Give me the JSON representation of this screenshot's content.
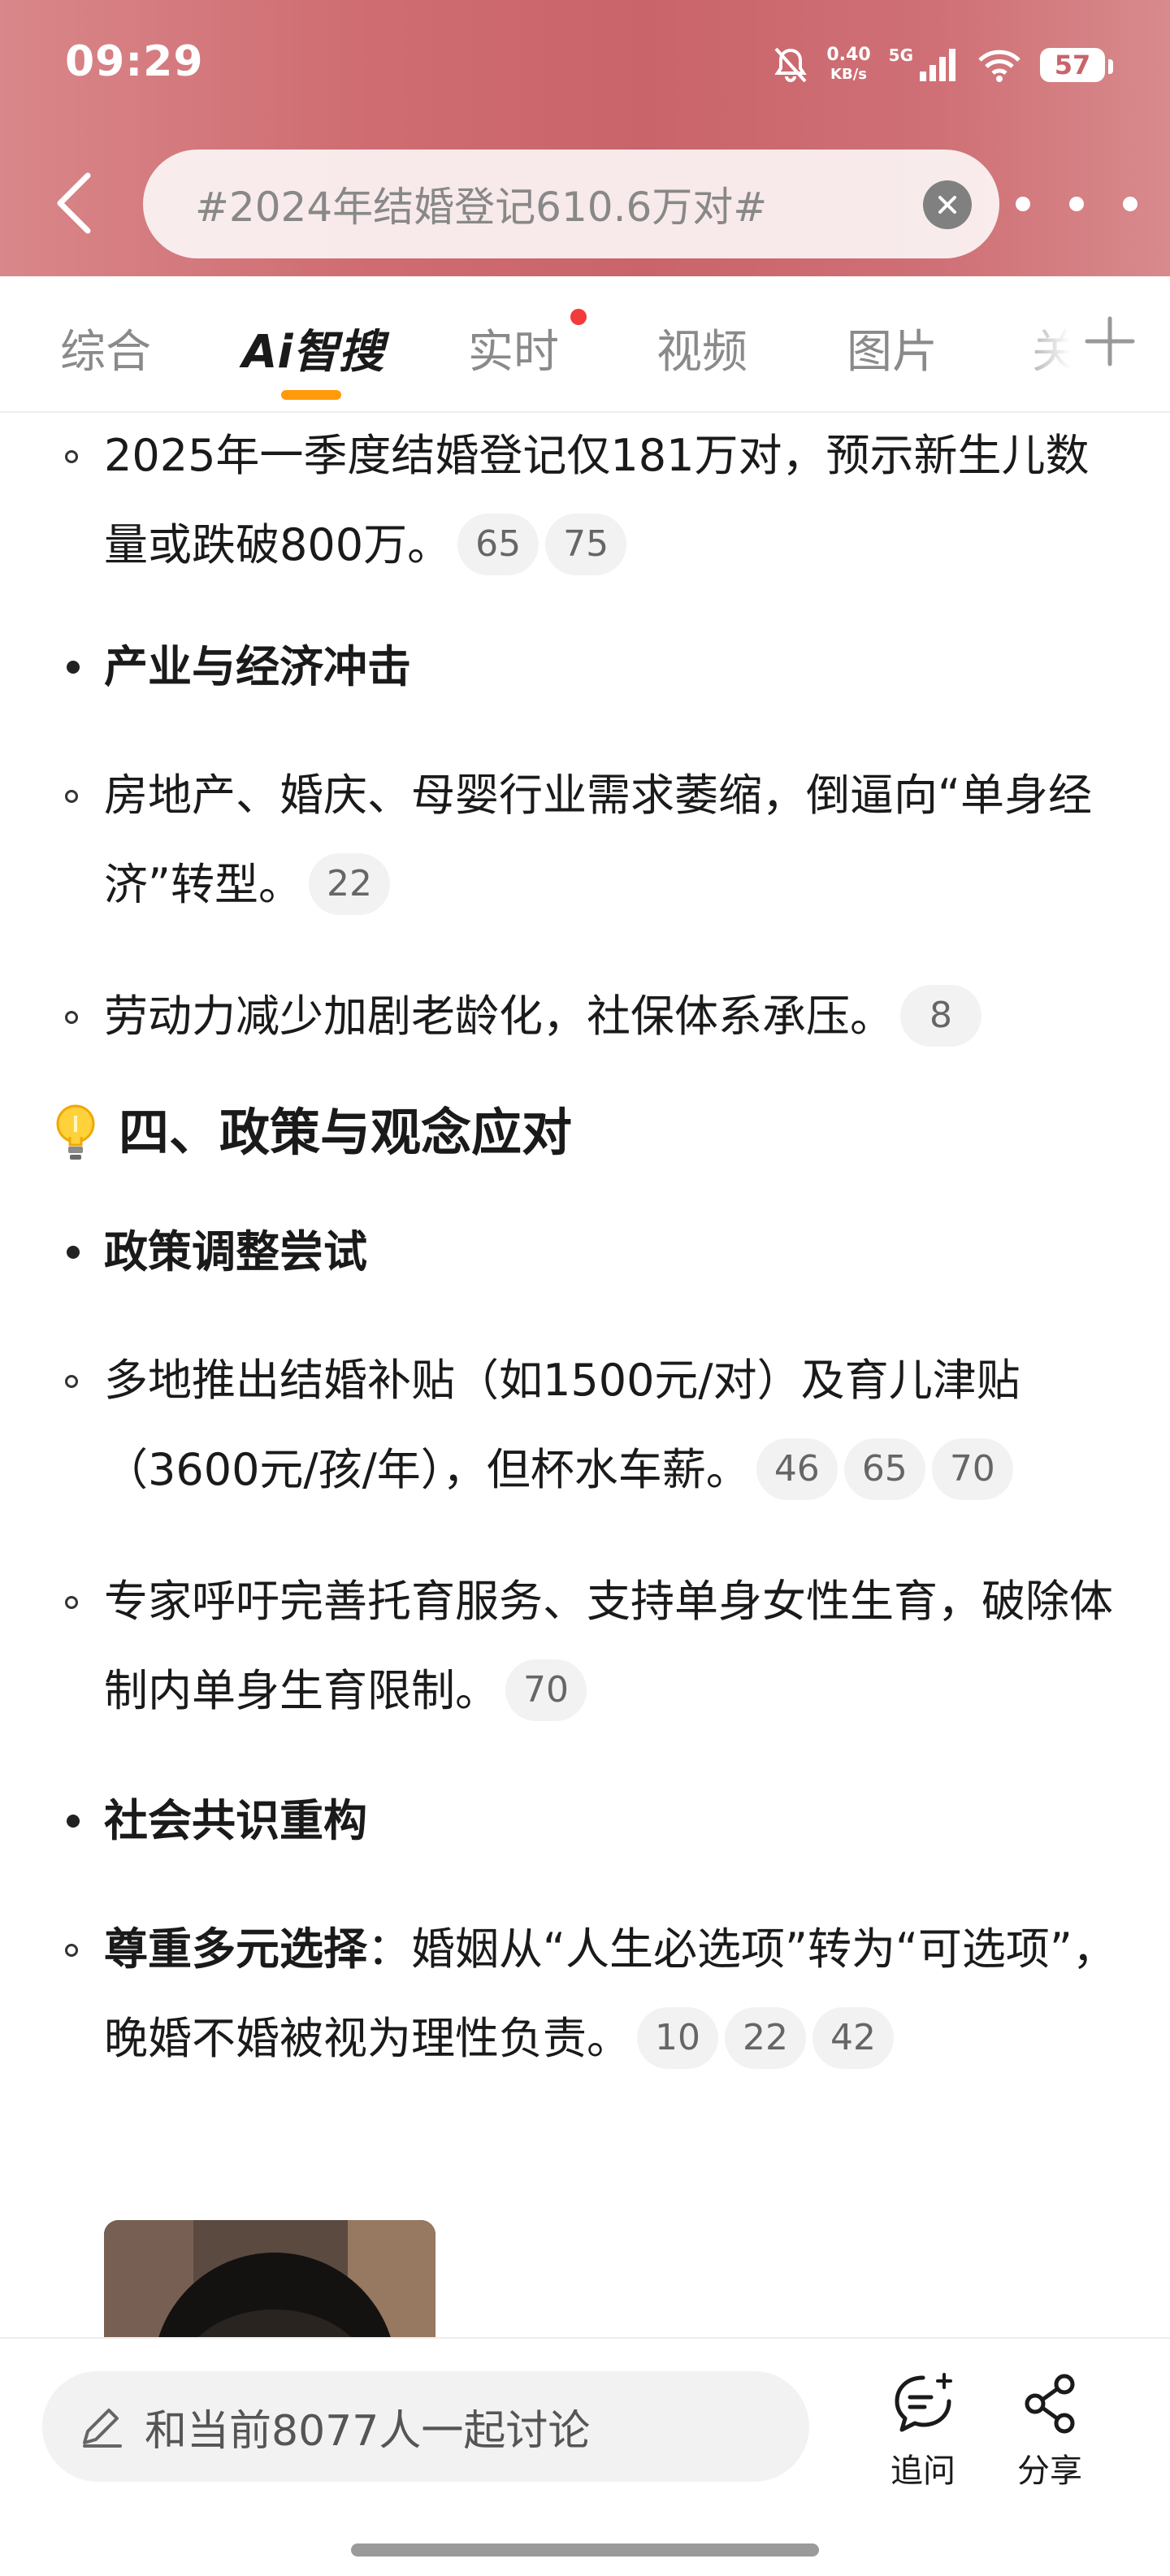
{
  "status_bar": {
    "time": "09:29",
    "net_speed_value": "0.40",
    "net_speed_unit": "KB/s",
    "network": "5G",
    "battery": "57"
  },
  "search": {
    "query": "#2024年结婚登记610.6万对#"
  },
  "tabs": [
    {
      "label": "综合",
      "active": false
    },
    {
      "label": "Ai智搜",
      "active": true
    },
    {
      "label": "实时",
      "active": false,
      "badge": "red-dot"
    },
    {
      "label": "视频",
      "active": false
    },
    {
      "label": "图片",
      "active": false
    },
    {
      "label": "关",
      "active": false
    }
  ],
  "content": {
    "item_q1": {
      "text": "2025年一季度结婚登记仅181万对，预示新生儿数量或跌破800万。",
      "cites": [
        "65",
        "75"
      ]
    },
    "heading_industry": "产业与经济冲击",
    "item_realestate": {
      "text": "房地产、婚庆、母婴行业需求萎缩，倒逼向“单身经济”转型。",
      "cites": [
        "22"
      ]
    },
    "item_labor": {
      "text": "劳动力减少加剧老龄化，社保体系承压。",
      "cites": [
        "8"
      ]
    },
    "section4_title": "四、政策与观念应对",
    "heading_policy": "政策调整尝试",
    "item_subsidy": {
      "text": "多地推出结婚补贴（如1500元/对）及育儿津贴（3600元/孩/年），但杯水车薪。",
      "cites": [
        "46",
        "65",
        "70"
      ]
    },
    "item_experts": {
      "text": "专家呼吁完善托育服务、支持单身女性生育，破除体制内单身生育限制。",
      "cites": [
        "70"
      ]
    },
    "heading_consensus": "社会共识重构",
    "item_respect": {
      "bold": "尊重多元选择",
      "text": "：婚姻从“人生必选项”转为“可选项”，晚婚不婚被视为理性负责。",
      "cites": [
        "10",
        "22",
        "42"
      ]
    }
  },
  "bottom_bar": {
    "discuss_placeholder": "和当前8077人一起讨论",
    "ask_label": "追问",
    "share_label": "分享"
  },
  "colors": {
    "header_gradient": "#cf6d72",
    "tab_underline": "#ff9a0a",
    "red_dot": "#f33b3b"
  }
}
